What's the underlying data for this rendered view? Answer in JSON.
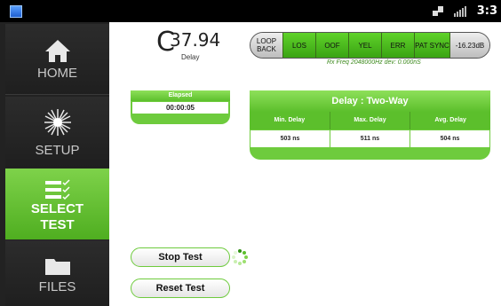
{
  "statusbar": {
    "time": "3:3"
  },
  "sidebar": {
    "items": [
      {
        "label": "HOME"
      },
      {
        "label": "SETUP"
      },
      {
        "label_line1": "SELECT",
        "label_line2": "TEST"
      },
      {
        "label": "FILES"
      }
    ]
  },
  "header": {
    "channel_letter": "C",
    "value": "37.94",
    "subtitle": "Delay"
  },
  "alarms": [
    {
      "label": "LOOP BACK",
      "state": "gray"
    },
    {
      "label": "LOS",
      "state": "green"
    },
    {
      "label": "OOF",
      "state": "green"
    },
    {
      "label": "YEL",
      "state": "green"
    },
    {
      "label": "ERR",
      "state": "green"
    },
    {
      "label": "PAT SYNC",
      "state": "green"
    },
    {
      "label": "-16.23dB",
      "state": "gray"
    }
  ],
  "freq_note": "Rx Freq 2048000Hz dev: 0.000nS",
  "elapsed": {
    "title": "Elapsed",
    "value": "00:00:05"
  },
  "delay_table": {
    "title": "Delay : Two-Way",
    "columns": [
      "Min. Delay",
      "Max. Delay",
      "Avg. Delay"
    ],
    "values": [
      "503 ns",
      "511 ns",
      "504 ns"
    ]
  },
  "buttons": {
    "stop": "Stop Test",
    "reset": "Reset Test"
  },
  "colors": {
    "accent": "#5cbf2c",
    "sidebar": "#222222"
  }
}
